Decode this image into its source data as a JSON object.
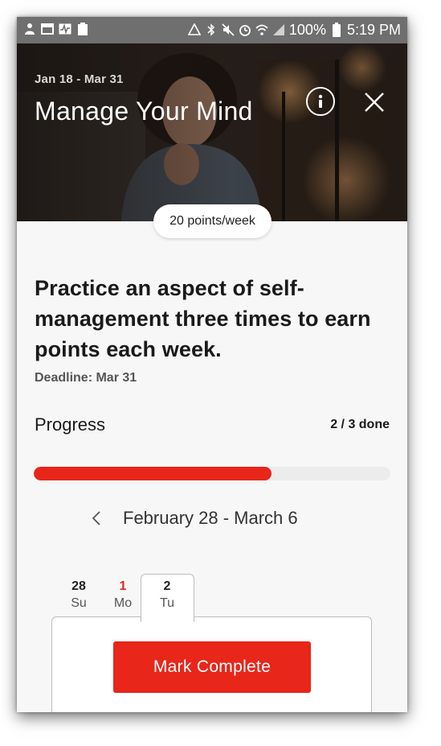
{
  "status_bar": {
    "battery": "100%",
    "time": "5:19 PM",
    "left_icons": [
      "app-notification-icon",
      "calendar-icon",
      "activity-icon",
      "battery-100-icon"
    ],
    "right_icons": [
      "android-icon",
      "bluetooth-icon",
      "mute-icon",
      "alarm-icon",
      "wifi-icon",
      "signal-icon",
      "battery-icon"
    ]
  },
  "header": {
    "date_range": "Jan 18 - Mar 31",
    "title": "Manage Your Mind",
    "info_icon": "info-icon",
    "close_icon": "close-icon"
  },
  "points_badge": "20 points/week",
  "challenge": {
    "description": "Practice an aspect of self-management three times to earn points each week.",
    "deadline": "Deadline: Mar 31"
  },
  "progress": {
    "label": "Progress",
    "count": "2 / 3 done",
    "fraction": 0.6667
  },
  "week": {
    "prev_icon": "chevron-left-icon",
    "label": "February 28 - March 6"
  },
  "days": [
    {
      "num": "28",
      "name": "Su"
    },
    {
      "num": "1",
      "name": "Mo"
    },
    {
      "num": "2",
      "name": "Tu"
    }
  ],
  "action": {
    "mark_complete": "Mark Complete"
  },
  "colors": {
    "accent": "#e8261a",
    "track": "#ececec",
    "status_bar": "#6f6f6f"
  }
}
